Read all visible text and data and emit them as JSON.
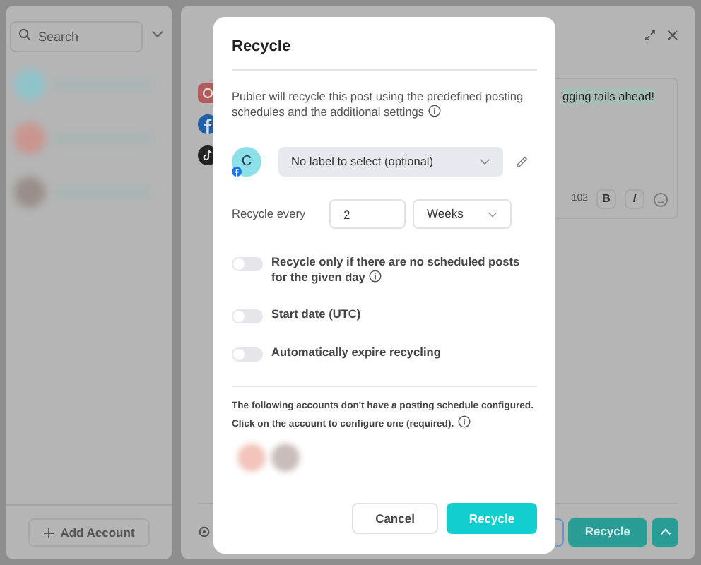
{
  "sidebar": {
    "search": {
      "placeholder": "Search"
    },
    "accounts": [
      {
        "color": "#8fc3c9"
      },
      {
        "color": "#c9958f"
      },
      {
        "color": "#9a8f88"
      }
    ],
    "add_account": "Add Account"
  },
  "editor": {
    "text": "gging tails ahead!",
    "char_count": "102",
    "format_buttons": [
      "B",
      "I"
    ],
    "recycle_button": "Recycle"
  },
  "dialog": {
    "title": "Recycle",
    "description": "Publer will recycle this post using the predefined posting schedules and the additional settings",
    "account_initial": "C",
    "label_select": {
      "placeholder": "No label to select (optional)"
    },
    "interval": {
      "label": "Recycle every",
      "value": "2",
      "unit": "Weeks"
    },
    "toggles": [
      {
        "label": "Recycle only if there are no scheduled posts for the given day",
        "on": false,
        "info": true
      },
      {
        "label": "Start date (UTC)",
        "on": false,
        "info": false
      },
      {
        "label": "Automatically expire recycling",
        "on": false,
        "info": false
      }
    ],
    "notice": [
      "The following accounts don't have a posting schedule configured.",
      "Click on the account to configure one (required)."
    ],
    "unconfigured_accounts": [
      {
        "color": "#f2c4bc"
      },
      {
        "color": "#c9bdbb"
      }
    ],
    "buttons": [
      {
        "label": "Cancel",
        "kind": "secondary"
      },
      {
        "label": "Recycle",
        "kind": "primary"
      }
    ]
  }
}
